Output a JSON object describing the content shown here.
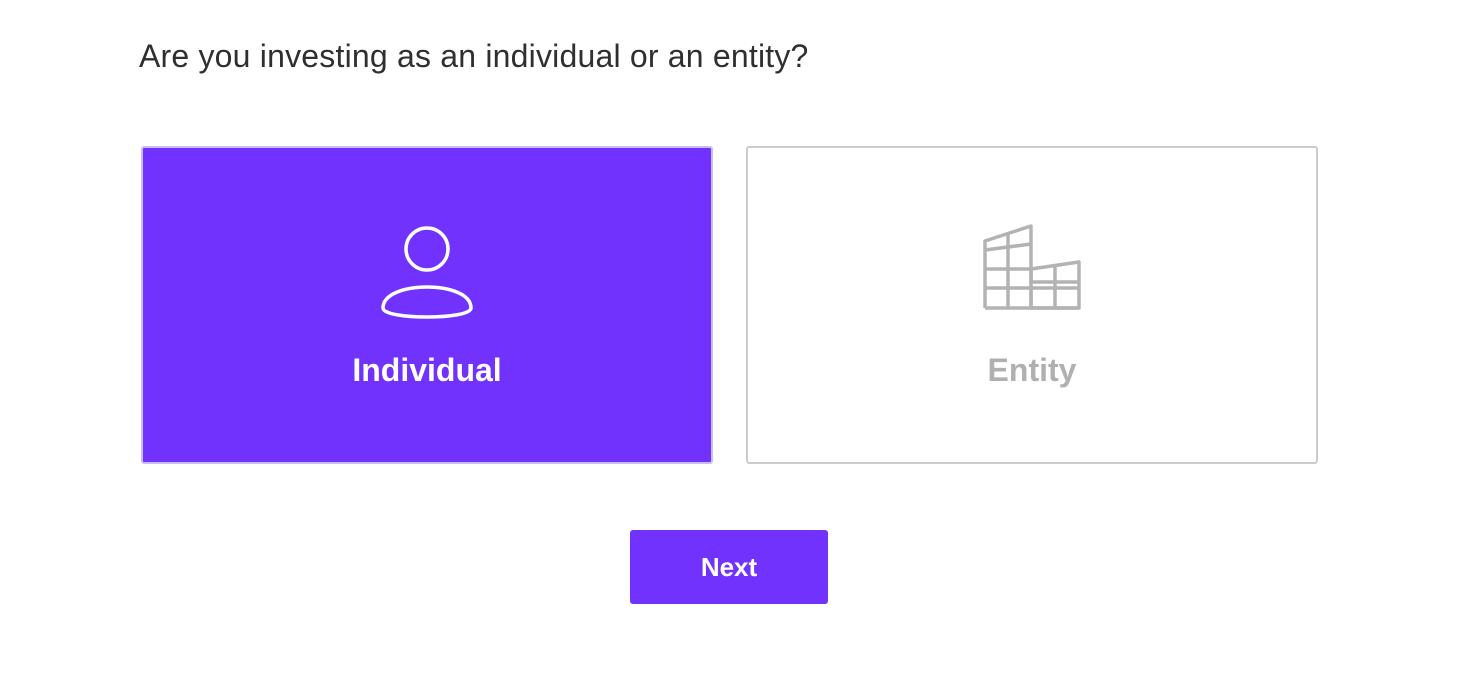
{
  "question": "Are you investing as an individual or an entity?",
  "options": [
    {
      "label": "Individual",
      "icon": "person-icon",
      "selected": true
    },
    {
      "label": "Entity",
      "icon": "building-icon",
      "selected": false
    }
  ],
  "next_label": "Next",
  "colors": {
    "accent": "#7132fd",
    "selected_text": "#ffffff",
    "unselected_text": "#b0b0b0",
    "unselected_border": "#cccccc",
    "question_text": "#2f2f2f"
  }
}
